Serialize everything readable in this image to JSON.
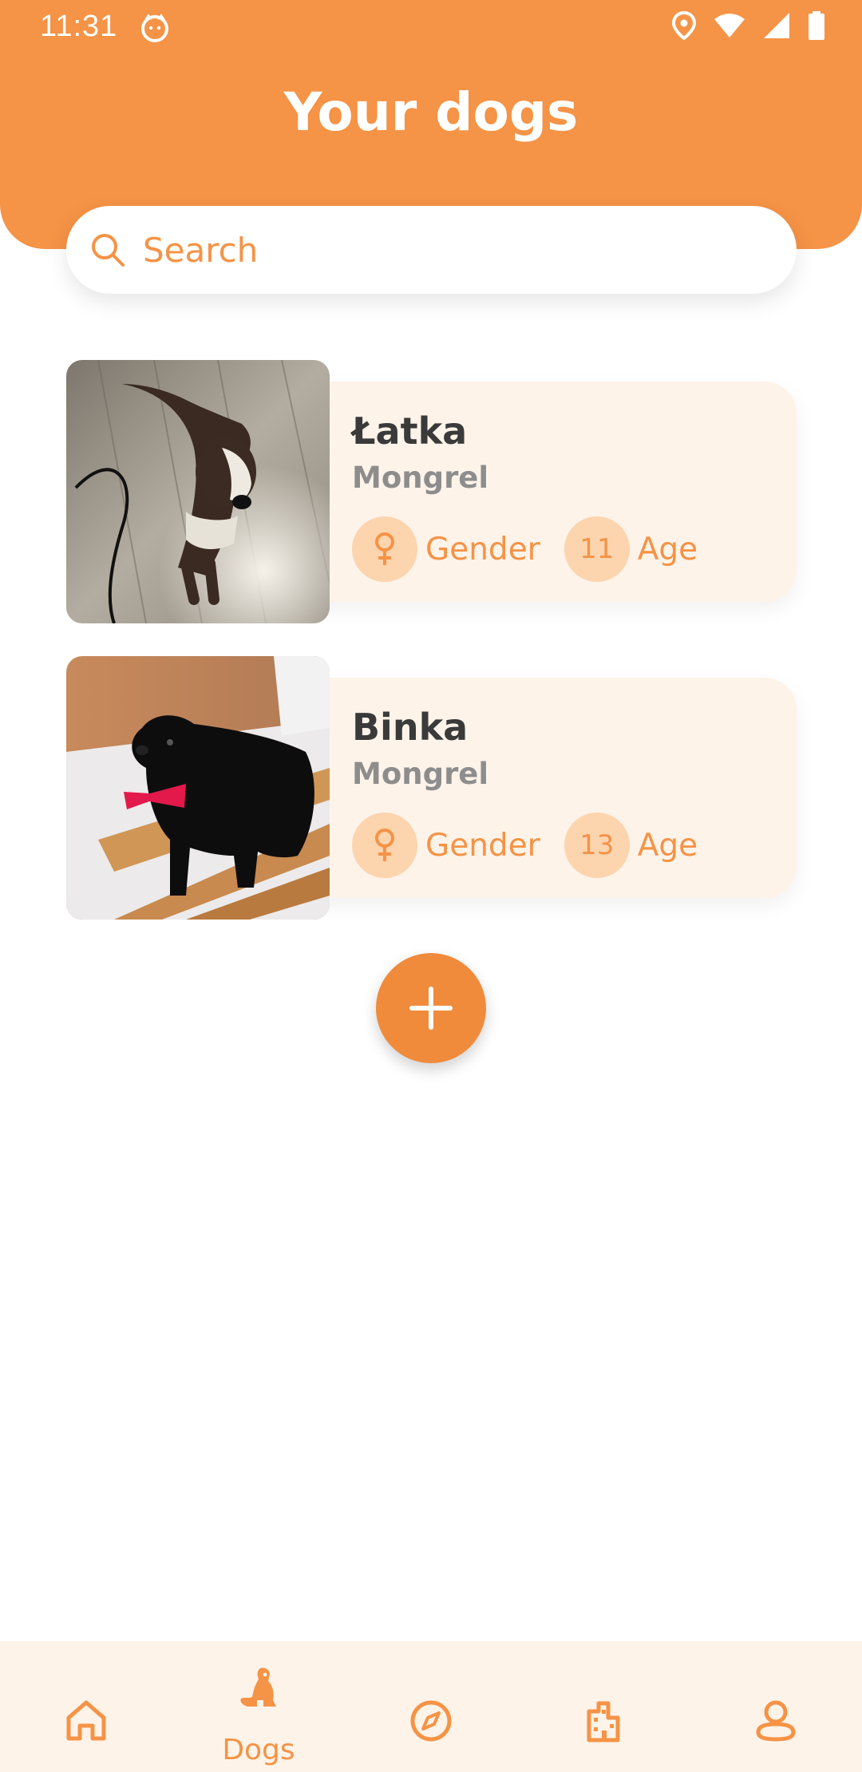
{
  "status_bar": {
    "time": "11:31"
  },
  "header": {
    "title": "Your dogs"
  },
  "search": {
    "placeholder": "Search"
  },
  "dogs": [
    {
      "name": "Łatka",
      "breed": "Mongrel",
      "gender_label": "Gender",
      "age_value": "11",
      "age_label": "Age"
    },
    {
      "name": "Binka",
      "breed": "Mongrel",
      "gender_label": "Gender",
      "age_value": "13",
      "age_label": "Age"
    }
  ],
  "bottom_nav": {
    "items": [
      {
        "icon": "home-icon",
        "label": ""
      },
      {
        "icon": "dog-icon",
        "label": "Dogs"
      },
      {
        "icon": "compass-icon",
        "label": ""
      },
      {
        "icon": "building-icon",
        "label": ""
      },
      {
        "icon": "profile-icon",
        "label": ""
      }
    ]
  },
  "colors": {
    "accent": "#F59346",
    "card_bg": "#FEF3E9",
    "circle_bg": "#FCD4AE"
  }
}
